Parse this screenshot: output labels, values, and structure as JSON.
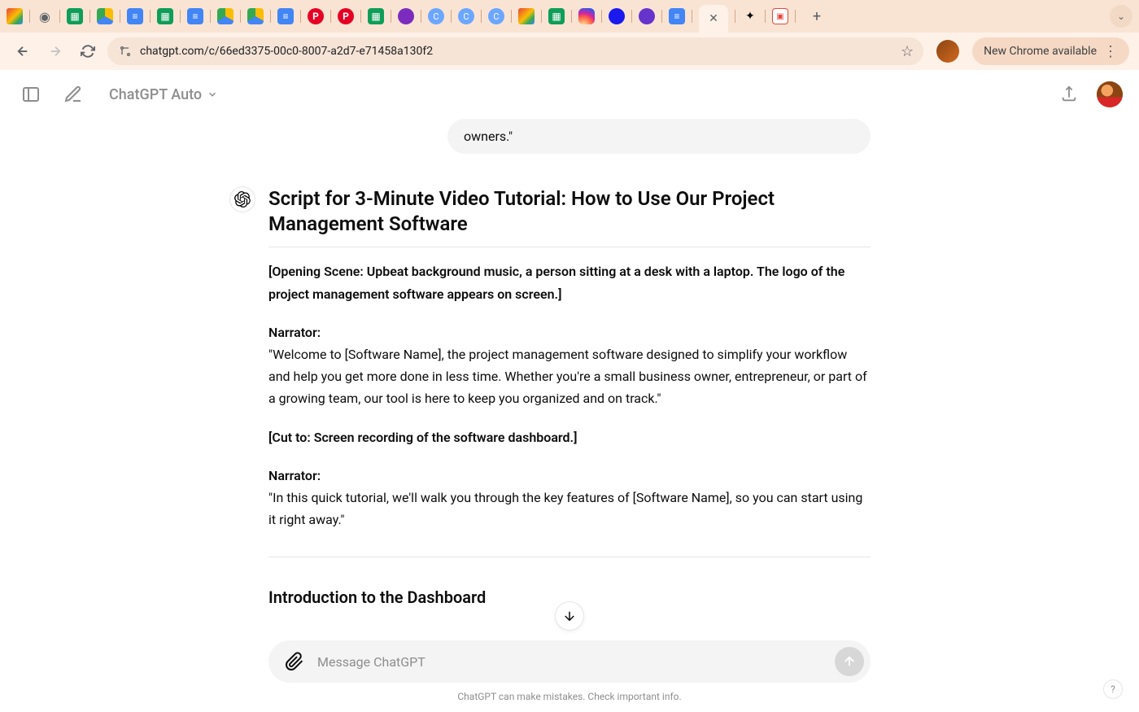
{
  "browser": {
    "url": "chatgpt.com/c/66ed3375-00c0-8007-a2d7-e71458a130f2",
    "update_label": "New Chrome available"
  },
  "header": {
    "model_name": "ChatGPT Auto"
  },
  "user_message_tail": "owners.\"",
  "response": {
    "title": "Script for 3-Minute Video Tutorial: How to Use Our Project Management Software",
    "opening_scene": "[Opening Scene: Upbeat background music, a person sitting at a desk with a laptop. The logo of the project management software appears on screen.]",
    "narrator1_label": "Narrator:",
    "narrator1_text": "\"Welcome to [Software Name], the project management software designed to simplify your workflow and help you get more done in less time. Whether you're a small business owner, entrepreneur, or part of a growing team, our tool is here to keep you organized and on track.\"",
    "cut_to": "[Cut to: Screen recording of the software dashboard.]",
    "narrator2_label": "Narrator:",
    "narrator2_text": "\"In this quick tutorial, we'll walk you through the key features of [Software Name], so you can start using it right away.\"",
    "section_heading": "Introduction to the Dashboard"
  },
  "input": {
    "placeholder": "Message ChatGPT"
  },
  "disclaimer": "ChatGPT can make mistakes. Check important info."
}
